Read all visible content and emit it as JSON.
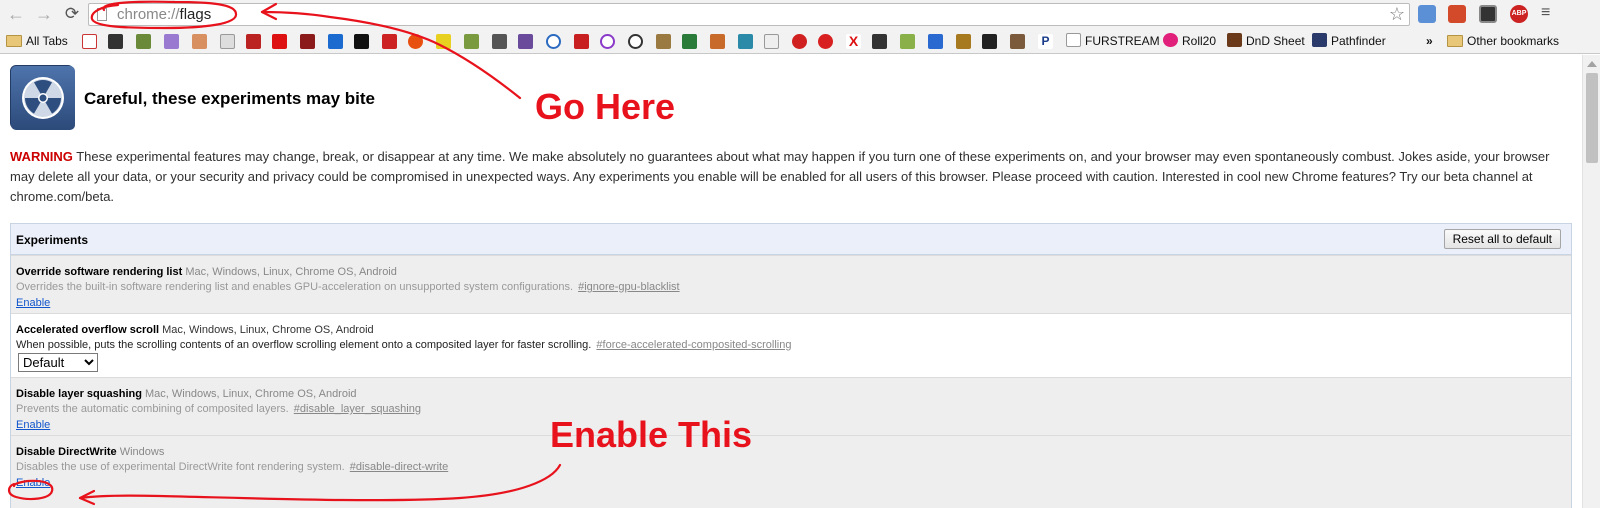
{
  "browser": {
    "back_icon": "back-arrow-icon",
    "forward_icon": "forward-arrow-icon",
    "reload_icon": "reload-icon",
    "url_scheme": "chrome://",
    "url_path": "flags",
    "bookmark_star_icon": "star-icon"
  },
  "bookmarks": {
    "all_tabs": "All Tabs",
    "furstream": "FURSTREAM",
    "roll20": "Roll20",
    "dnd_sheet": "DnD Sheet",
    "pathfinder": "Pathfinder",
    "overflow": "»",
    "other": "Other bookmarks"
  },
  "page": {
    "heading": "Careful, these experiments may bite",
    "warning_label": "WARNING",
    "warning_text": " These experimental features may change, break, or disappear at any time. We make absolutely no guarantees about what may happen if you turn one of these experiments on, and your browser may even spontaneously combust. Jokes aside, your browser may delete all your data, or your security and privacy could be compromised in unexpected ways. Any experiments you enable will be enabled for all users of this browser. Please proceed with caution. Interested in cool new Chrome features? Try our beta channel at chrome.com/beta.",
    "experiments_title": "Experiments",
    "reset_button": "Reset all to default"
  },
  "experiments": [
    {
      "name": "Override software rendering list",
      "platforms": " Mac, Windows, Linux, Chrome OS, Android",
      "description": "Overrides the built-in software rendering list and enables GPU-acceleration on unsupported system configurations.",
      "anchor": "#ignore-gpu-blacklist",
      "action": "Enable"
    },
    {
      "name": "Accelerated overflow scroll",
      "platforms": " Mac, Windows, Linux, Chrome OS, Android",
      "description": "When possible, puts the scrolling contents of an overflow scrolling element onto a composited layer for faster scrolling.",
      "anchor": "#force-accelerated-composited-scrolling",
      "select_value": "Default"
    },
    {
      "name": "Disable layer squashing",
      "platforms": " Mac, Windows, Linux, Chrome OS, Android",
      "description": "Prevents the automatic combining of composited layers.",
      "anchor": "#disable_layer_squashing",
      "action": "Enable"
    },
    {
      "name": "Disable DirectWrite",
      "platforms": " Windows",
      "description": "Disables the use of experimental DirectWrite font rendering system.",
      "anchor": "#disable-direct-write",
      "action": "Enable"
    }
  ],
  "annotations": {
    "go_here": "Go Here",
    "enable_this": "Enable This",
    "color": "#e8121c"
  },
  "colors": {
    "warning": "#cc0000",
    "link": "#1155cc",
    "experiments_header_bg": "#ebeff9"
  }
}
